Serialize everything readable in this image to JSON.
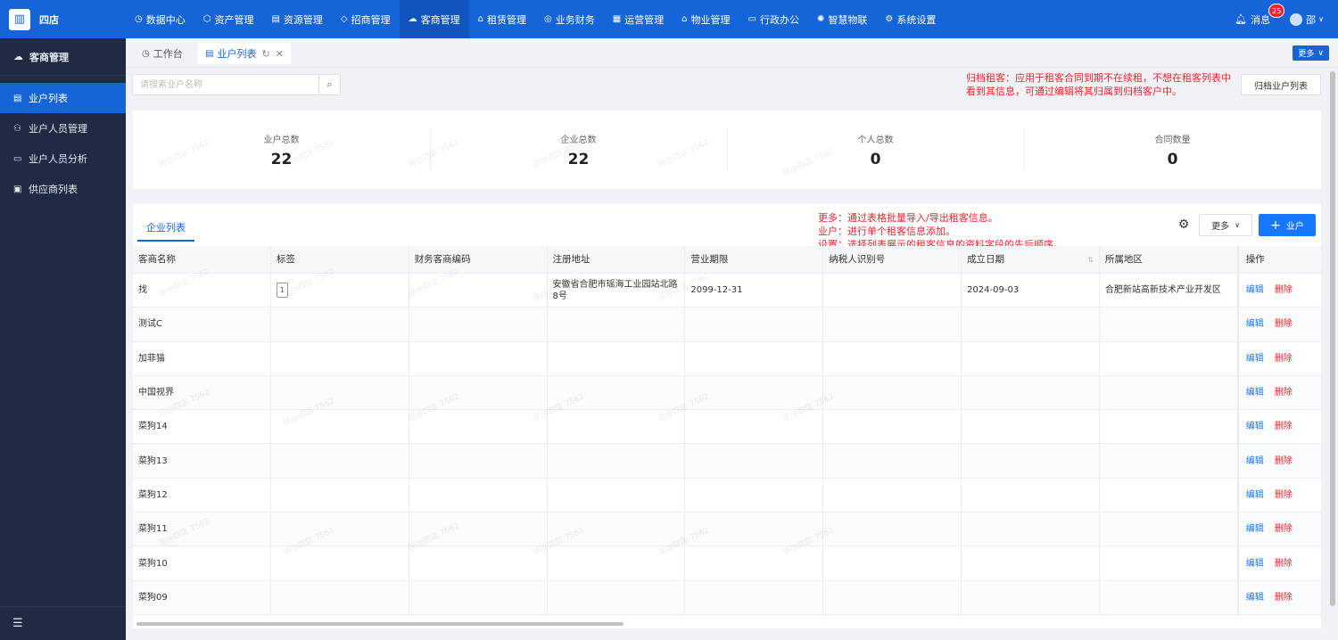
{
  "app": {
    "logo_text": "四店"
  },
  "nav": {
    "items": [
      {
        "label": "数据中心",
        "icon": "◷"
      },
      {
        "label": "资产管理",
        "icon": "⬡"
      },
      {
        "label": "资源管理",
        "icon": "▤"
      },
      {
        "label": "招商管理",
        "icon": "◇"
      },
      {
        "label": "客商管理",
        "icon": "☁"
      },
      {
        "label": "租赁管理",
        "icon": "⌂"
      },
      {
        "label": "业务财务",
        "icon": "◎"
      },
      {
        "label": "运营管理",
        "icon": "▦"
      },
      {
        "label": "物业管理",
        "icon": "⌂"
      },
      {
        "label": "行政办公",
        "icon": "▭"
      },
      {
        "label": "智慧物联",
        "icon": "✺"
      },
      {
        "label": "系统设置",
        "icon": "⚙"
      }
    ],
    "message_label": "消息",
    "message_count": "25",
    "user_name": "邵"
  },
  "sidebar": {
    "title": "客商管理",
    "items": [
      {
        "label": "业户列表"
      },
      {
        "label": "业户人员管理"
      },
      {
        "label": "业户人员分析"
      },
      {
        "label": "供应商列表"
      }
    ]
  },
  "tabs": {
    "workbench": "工作台",
    "current": "业户列表",
    "more": "更多"
  },
  "toolbar": {
    "search_placeholder": "请搜索业户名称",
    "archive_button": "归档业户列表",
    "note": "归档租客：应用于租客合同到期不在续租，不想在租客列表中看到其信息，可通过编辑将其归属到归档客户中。"
  },
  "stats": [
    {
      "label": "业户总数",
      "value": "22"
    },
    {
      "label": "企业总数",
      "value": "22"
    },
    {
      "label": "个人总数",
      "value": "0"
    },
    {
      "label": "合同数量",
      "value": "0"
    }
  ],
  "list": {
    "tab_label": "企业列表",
    "note_lines": [
      "更多：通过表格批量导入/导出租客信息。",
      "业户：进行单个租客信息添加。",
      "设置：选择列表展示的租客信息的资料字段的先后顺序。"
    ],
    "more_button": "更多",
    "add_button": "业户",
    "columns": [
      "客商名称",
      "标签",
      "财务客商编码",
      "注册地址",
      "营业期限",
      "纳税人识别号",
      "成立日期",
      "所属地区"
    ],
    "op_column": "操作",
    "edit_label": "编辑",
    "delete_label": "删除",
    "rows": [
      {
        "name": "找",
        "tag": "1",
        "code": "",
        "address": "安徽省合肥市瑶海工业园站北路8号",
        "term": "2099-12-31",
        "tax": "",
        "date": "2024-09-03",
        "region": "合肥新站高新技术产业开发区"
      },
      {
        "name": "测试C",
        "tag": "",
        "code": "",
        "address": "",
        "term": "",
        "tax": "",
        "date": "",
        "region": ""
      },
      {
        "name": "加菲猫",
        "tag": "",
        "code": "",
        "address": "",
        "term": "",
        "tax": "",
        "date": "",
        "region": ""
      },
      {
        "name": "中国视界",
        "tag": "",
        "code": "",
        "address": "",
        "term": "",
        "tax": "",
        "date": "",
        "region": ""
      },
      {
        "name": "菜狗14",
        "tag": "",
        "code": "",
        "address": "",
        "term": "",
        "tax": "",
        "date": "",
        "region": ""
      },
      {
        "name": "菜狗13",
        "tag": "",
        "code": "",
        "address": "",
        "term": "",
        "tax": "",
        "date": "",
        "region": ""
      },
      {
        "name": "菜狗12",
        "tag": "",
        "code": "",
        "address": "",
        "term": "",
        "tax": "",
        "date": "",
        "region": ""
      },
      {
        "name": "菜狗11",
        "tag": "",
        "code": "",
        "address": "",
        "term": "",
        "tax": "",
        "date": "",
        "region": ""
      },
      {
        "name": "菜狗10",
        "tag": "",
        "code": "",
        "address": "",
        "term": "",
        "tax": "",
        "date": "",
        "region": ""
      },
      {
        "name": "菜狗09",
        "tag": "",
        "code": "",
        "address": "",
        "term": "",
        "tax": "",
        "date": "",
        "region": ""
      }
    ]
  },
  "watermark": "邵@四店 7562",
  "colors": {
    "primary": "#1565d8",
    "sidebar": "#1f2a44",
    "danger": "#f5222d"
  }
}
